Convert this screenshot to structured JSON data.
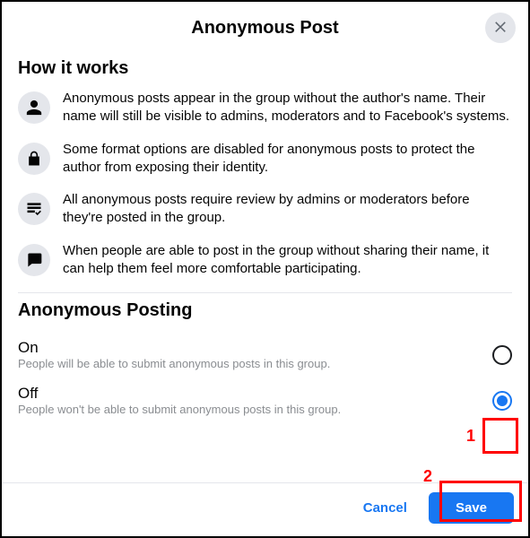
{
  "header": {
    "title": "Anonymous Post"
  },
  "howItWorks": {
    "heading": "How it works",
    "items": [
      {
        "icon": "person-icon",
        "text": "Anonymous posts appear in the group without the author's name. Their name will still be visible to admins, moderators and to Facebook's systems."
      },
      {
        "icon": "lock-icon",
        "text": "Some format options are disabled for anonymous posts to protect the author from exposing their identity."
      },
      {
        "icon": "review-icon",
        "text": "All anonymous posts require review by admins or moderators before they're posted in the group."
      },
      {
        "icon": "comment-icon",
        "text": "When people are able to post in the group without sharing their name, it can help them feel more comfortable participating."
      }
    ]
  },
  "anonymousPosting": {
    "heading": "Anonymous Posting",
    "options": [
      {
        "title": "On",
        "desc": "People will be able to submit anonymous posts in this group.",
        "selected": false
      },
      {
        "title": "Off",
        "desc": "People won't be able to submit anonymous posts in this group.",
        "selected": true
      }
    ]
  },
  "footer": {
    "cancel": "Cancel",
    "save": "Save"
  },
  "annotations": {
    "n1": "1",
    "n2": "2"
  }
}
